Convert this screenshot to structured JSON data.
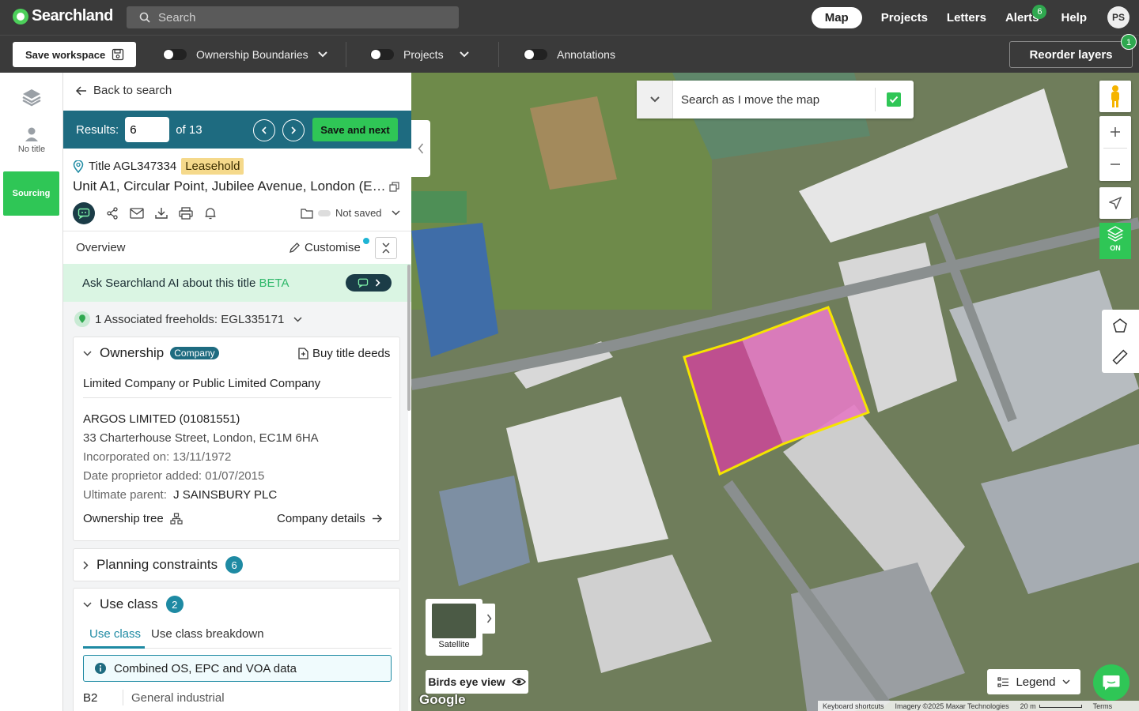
{
  "topbar": {
    "app_name": "Searchland",
    "search_placeholder": "Search",
    "nav": {
      "map": "Map",
      "projects": "Projects",
      "letters": "Letters",
      "alerts": "Alerts",
      "alerts_count": "6",
      "help": "Help",
      "avatar_initials": "PS"
    }
  },
  "toolbar": {
    "save_workspace": "Save workspace",
    "ownership_boundaries": "Ownership Boundaries",
    "projects": "Projects",
    "annotations": "Annotations",
    "reorder_layers": "Reorder layers",
    "reorder_badge": "1"
  },
  "rail": {
    "no_title": "No title",
    "sourcing": "Sourcing"
  },
  "panel": {
    "back": "Back to search",
    "results_label": "Results:",
    "results_value": "6",
    "results_of": "of 13",
    "save_next": "Save and next",
    "title_number": "Title AGL347334",
    "tenure": "Leasehold",
    "address": "Unit A1, Circular Point, Jubilee Avenue, London (E4...",
    "not_saved": "Not saved",
    "overview": "Overview",
    "customise": "Customise",
    "ai_text": "Ask Searchland AI about this title",
    "ai_beta": "BETA",
    "associated": "1 Associated freeholds: EGL335171",
    "ownership": {
      "title": "Ownership",
      "pill": "Company",
      "buy_deeds": "Buy title deeds",
      "type": "Limited Company or Public Limited Company",
      "company": "ARGOS LIMITED (01081551)",
      "address": "33 Charterhouse Street, London, EC1M 6HA",
      "incorporated": "Incorporated on: 13/11/1972",
      "proprietor_added": "Date proprietor added: 01/07/2015",
      "parent_label": "Ultimate parent:",
      "parent_value": "J SAINSBURY PLC",
      "tree": "Ownership tree",
      "details": "Company details"
    },
    "planning": {
      "title": "Planning constraints",
      "count": "6"
    },
    "use_class": {
      "title": "Use class",
      "count": "2",
      "tab1": "Use class",
      "tab2": "Use class breakdown",
      "notice": "Combined OS, EPC and VOA data",
      "code": "B2",
      "desc": "General industrial"
    }
  },
  "map": {
    "search_as_move": "Search as I move the map",
    "layers_on": "ON",
    "satellite": "Satellite",
    "birds_eye": "Birds eye view",
    "google": "Google",
    "legend": "Legend",
    "attrib_shortcuts": "Keyboard shortcuts",
    "attrib_imagery": "Imagery ©2025 Maxar Technologies",
    "attrib_scale": "20 m",
    "attrib_terms": "Terms",
    "colors": {
      "boundary": "#f5e400",
      "highlight": "#e04fa8"
    }
  }
}
